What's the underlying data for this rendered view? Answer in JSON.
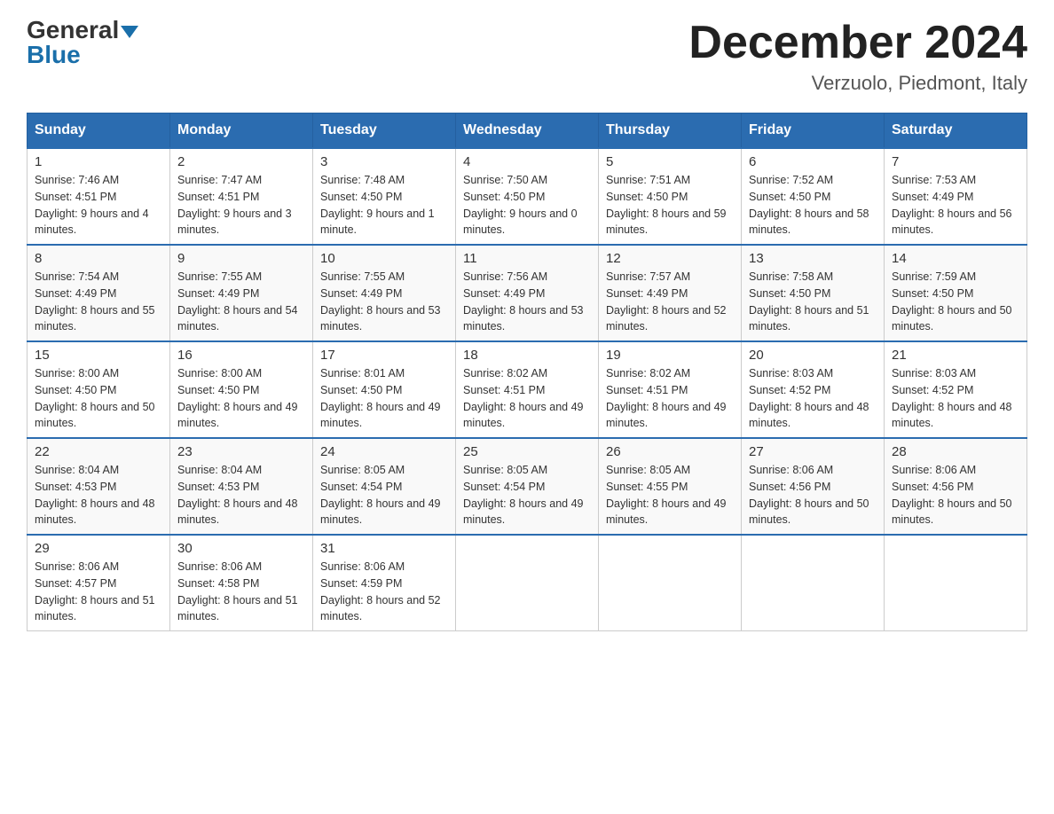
{
  "header": {
    "logo_general": "General",
    "logo_blue": "Blue",
    "month_title": "December 2024",
    "location": "Verzuolo, Piedmont, Italy"
  },
  "columns": [
    "Sunday",
    "Monday",
    "Tuesday",
    "Wednesday",
    "Thursday",
    "Friday",
    "Saturday"
  ],
  "weeks": [
    [
      {
        "day": "1",
        "sunrise": "7:46 AM",
        "sunset": "4:51 PM",
        "daylight": "9 hours and 4 minutes."
      },
      {
        "day": "2",
        "sunrise": "7:47 AM",
        "sunset": "4:51 PM",
        "daylight": "9 hours and 3 minutes."
      },
      {
        "day": "3",
        "sunrise": "7:48 AM",
        "sunset": "4:50 PM",
        "daylight": "9 hours and 1 minute."
      },
      {
        "day": "4",
        "sunrise": "7:50 AM",
        "sunset": "4:50 PM",
        "daylight": "9 hours and 0 minutes."
      },
      {
        "day": "5",
        "sunrise": "7:51 AM",
        "sunset": "4:50 PM",
        "daylight": "8 hours and 59 minutes."
      },
      {
        "day": "6",
        "sunrise": "7:52 AM",
        "sunset": "4:50 PM",
        "daylight": "8 hours and 58 minutes."
      },
      {
        "day": "7",
        "sunrise": "7:53 AM",
        "sunset": "4:49 PM",
        "daylight": "8 hours and 56 minutes."
      }
    ],
    [
      {
        "day": "8",
        "sunrise": "7:54 AM",
        "sunset": "4:49 PM",
        "daylight": "8 hours and 55 minutes."
      },
      {
        "day": "9",
        "sunrise": "7:55 AM",
        "sunset": "4:49 PM",
        "daylight": "8 hours and 54 minutes."
      },
      {
        "day": "10",
        "sunrise": "7:55 AM",
        "sunset": "4:49 PM",
        "daylight": "8 hours and 53 minutes."
      },
      {
        "day": "11",
        "sunrise": "7:56 AM",
        "sunset": "4:49 PM",
        "daylight": "8 hours and 53 minutes."
      },
      {
        "day": "12",
        "sunrise": "7:57 AM",
        "sunset": "4:49 PM",
        "daylight": "8 hours and 52 minutes."
      },
      {
        "day": "13",
        "sunrise": "7:58 AM",
        "sunset": "4:50 PM",
        "daylight": "8 hours and 51 minutes."
      },
      {
        "day": "14",
        "sunrise": "7:59 AM",
        "sunset": "4:50 PM",
        "daylight": "8 hours and 50 minutes."
      }
    ],
    [
      {
        "day": "15",
        "sunrise": "8:00 AM",
        "sunset": "4:50 PM",
        "daylight": "8 hours and 50 minutes."
      },
      {
        "day": "16",
        "sunrise": "8:00 AM",
        "sunset": "4:50 PM",
        "daylight": "8 hours and 49 minutes."
      },
      {
        "day": "17",
        "sunrise": "8:01 AM",
        "sunset": "4:50 PM",
        "daylight": "8 hours and 49 minutes."
      },
      {
        "day": "18",
        "sunrise": "8:02 AM",
        "sunset": "4:51 PM",
        "daylight": "8 hours and 49 minutes."
      },
      {
        "day": "19",
        "sunrise": "8:02 AM",
        "sunset": "4:51 PM",
        "daylight": "8 hours and 49 minutes."
      },
      {
        "day": "20",
        "sunrise": "8:03 AM",
        "sunset": "4:52 PM",
        "daylight": "8 hours and 48 minutes."
      },
      {
        "day": "21",
        "sunrise": "8:03 AM",
        "sunset": "4:52 PM",
        "daylight": "8 hours and 48 minutes."
      }
    ],
    [
      {
        "day": "22",
        "sunrise": "8:04 AM",
        "sunset": "4:53 PM",
        "daylight": "8 hours and 48 minutes."
      },
      {
        "day": "23",
        "sunrise": "8:04 AM",
        "sunset": "4:53 PM",
        "daylight": "8 hours and 48 minutes."
      },
      {
        "day": "24",
        "sunrise": "8:05 AM",
        "sunset": "4:54 PM",
        "daylight": "8 hours and 49 minutes."
      },
      {
        "day": "25",
        "sunrise": "8:05 AM",
        "sunset": "4:54 PM",
        "daylight": "8 hours and 49 minutes."
      },
      {
        "day": "26",
        "sunrise": "8:05 AM",
        "sunset": "4:55 PM",
        "daylight": "8 hours and 49 minutes."
      },
      {
        "day": "27",
        "sunrise": "8:06 AM",
        "sunset": "4:56 PM",
        "daylight": "8 hours and 50 minutes."
      },
      {
        "day": "28",
        "sunrise": "8:06 AM",
        "sunset": "4:56 PM",
        "daylight": "8 hours and 50 minutes."
      }
    ],
    [
      {
        "day": "29",
        "sunrise": "8:06 AM",
        "sunset": "4:57 PM",
        "daylight": "8 hours and 51 minutes."
      },
      {
        "day": "30",
        "sunrise": "8:06 AM",
        "sunset": "4:58 PM",
        "daylight": "8 hours and 51 minutes."
      },
      {
        "day": "31",
        "sunrise": "8:06 AM",
        "sunset": "4:59 PM",
        "daylight": "8 hours and 52 minutes."
      },
      null,
      null,
      null,
      null
    ]
  ]
}
